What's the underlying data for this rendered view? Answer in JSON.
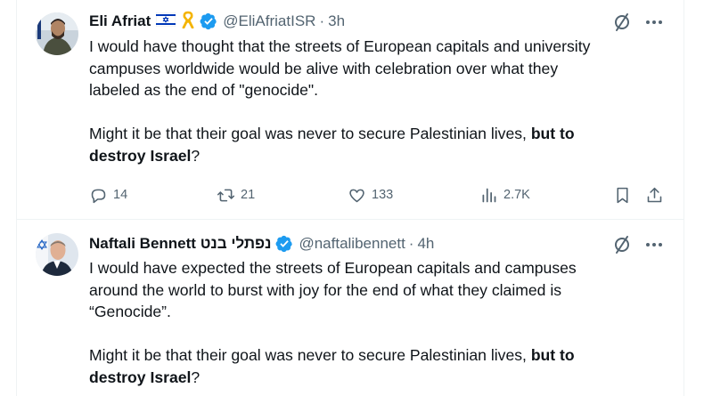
{
  "tweets": [
    {
      "display_name": "Eli Afriat",
      "emoji_flag": "🇮🇱",
      "emoji_ribbon": "🎗",
      "handle": "@EliAfriatISR",
      "separator": "·",
      "time": "3h",
      "text_line_1": "I would have thought that the streets of European capitals and university",
      "text_line_2": "campuses worldwide would be alive with celebration over what they",
      "text_line_3": "labeled as the end of \"genocide\".",
      "text_para2_start": "Might it be that their goal was never to secure Palestinian lives, ",
      "text_para2_bold_1": "but to",
      "text_para2_bold_2": "destroy Israel",
      "text_para2_end": "?",
      "replies": "14",
      "retweets": "21",
      "likes": "133",
      "views": "2.7K"
    },
    {
      "display_name": "Naftali Bennett נפתלי בנט",
      "handle": "@naftalibennett",
      "separator": "·",
      "time": "4h",
      "text_line_1": "I would have expected the streets of European capitals and campuses",
      "text_line_2": "around the world to burst with joy for the end of what they claimed is",
      "text_line_3": "“Genocide”.",
      "text_para2_start": "Might it be that their goal was never to secure Palestinian lives, ",
      "text_para2_bold_1": "but to",
      "text_para2_bold_2": "destroy Israel",
      "text_para2_end": "?"
    }
  ],
  "colors": {
    "text": "#0f1419",
    "secondary": "#536471",
    "verified": "#1d9bf0",
    "divider": "#eff3f4"
  },
  "icons": [
    "verified-badge-icon",
    "grok-icon",
    "more-icon",
    "reply-icon",
    "retweet-icon",
    "like-icon",
    "views-icon",
    "bookmark-icon",
    "share-icon"
  ]
}
